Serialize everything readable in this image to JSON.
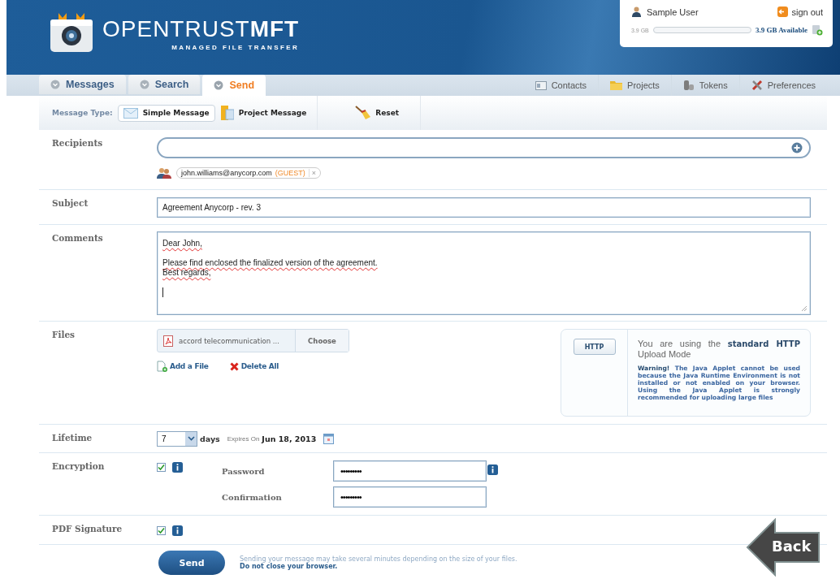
{
  "header": {
    "logo_light": "OPENTRUST",
    "logo_bold": "MFT",
    "tagline": "MANAGED FILE TRANSFER"
  },
  "user_panel": {
    "user": "Sample User",
    "sign_out": "sign out",
    "used": "3.9 GB",
    "available": "3.9 GB Available"
  },
  "tabs": [
    {
      "label": "Messages",
      "selected": false
    },
    {
      "label": "Search",
      "selected": false
    },
    {
      "label": "Send",
      "selected": true
    }
  ],
  "nav_links": [
    {
      "label": "Contacts"
    },
    {
      "label": "Projects"
    },
    {
      "label": "Tokens"
    },
    {
      "label": "Preferences"
    }
  ],
  "message_type": {
    "label": "Message Type:",
    "options": [
      {
        "label": "Simple Message",
        "selected": true
      },
      {
        "label": "Project Message",
        "selected": false
      }
    ],
    "reset": "Reset"
  },
  "recipients": {
    "label": "Recipients",
    "chips": [
      {
        "email": "john.williams@anycorp.com",
        "tag": "(GUEST)",
        "remove": "×"
      }
    ]
  },
  "subject": {
    "label": "Subject",
    "value": "Agreement Anycorp - rev. 3"
  },
  "comments": {
    "label": "Comments",
    "paragraphs": [
      [
        "Dear John,"
      ],
      [
        "Please find enclosed the finalized version of the agreement.",
        "Best regards,"
      ]
    ]
  },
  "files": {
    "label": "Files",
    "file_name": "accord telecommunication ...",
    "choose": "Choose",
    "add": "Add a File",
    "delete": "Delete All",
    "mode_button": "HTTP",
    "mode_text": "You are using the **standard HTTP** Upload Mode",
    "warning": "**Warning!** The Java Applet cannot be used because the Java Runtime Environment is not installed or not enabled on your browser. Using the Java Applet is strongly recommended for uploading large files"
  },
  "lifetime": {
    "label": "Lifetime",
    "value": "7",
    "unit": "days",
    "expires_label": "Expires On",
    "expires_date": "Jun 18, 2013"
  },
  "encryption": {
    "label": "Encryption",
    "checked": true,
    "password_label": "Password",
    "password": "•••••••••",
    "confirmation_label": "Confirmation",
    "confirmation": "•••••••••"
  },
  "pdf_signature": {
    "label": "PDF Signature",
    "checked": true
  },
  "send": {
    "button": "Send",
    "note": "Sending your message may take several minutes depending on the size of your files.",
    "note_strong": "Do not close your browser."
  },
  "back": {
    "label": "Back"
  }
}
